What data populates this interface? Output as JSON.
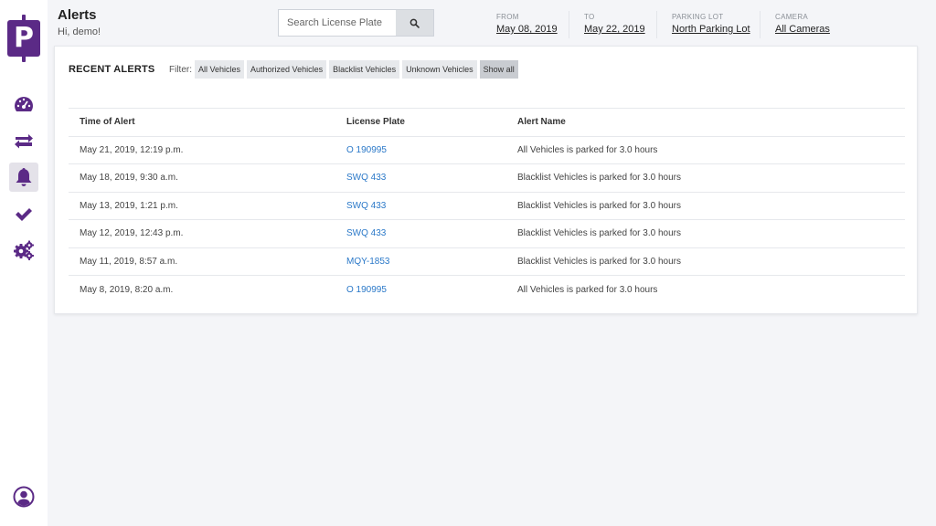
{
  "header": {
    "title": "Alerts",
    "greeting": "Hi, demo!",
    "search": {
      "placeholder": "Search License Plate",
      "value": ""
    },
    "filters": [
      {
        "label": "FROM",
        "value": "May 08, 2019"
      },
      {
        "label": "TO",
        "value": "May 22, 2019"
      },
      {
        "label": "PARKING LOT",
        "value": "North Parking Lot"
      },
      {
        "label": "CAMERA",
        "value": "All Cameras"
      }
    ]
  },
  "sidebar": {
    "logo_letter": "P",
    "brand_color": "#5b2a86",
    "items": [
      {
        "icon": "dashboard-icon"
      },
      {
        "icon": "transfer-arrows-icon"
      },
      {
        "icon": "bell-icon",
        "active": true
      },
      {
        "icon": "checkmark-icon"
      },
      {
        "icon": "gears-icon"
      }
    ],
    "profile_icon": "user-circle-icon"
  },
  "alerts": {
    "title": "RECENT ALERTS",
    "filter_label": "Filter:",
    "chips": [
      {
        "label": "All Vehicles"
      },
      {
        "label": "Authorized Vehicles"
      },
      {
        "label": "Blacklist Vehicles"
      },
      {
        "label": "Unknown Vehicles"
      },
      {
        "label": "Show all",
        "active": true
      }
    ],
    "columns": [
      "Time of Alert",
      "License Plate",
      "Alert Name"
    ],
    "rows": [
      {
        "time": "May 21, 2019, 12:19 p.m.",
        "plate": "O 190995",
        "name": "All Vehicles is parked for 3.0 hours"
      },
      {
        "time": "May 18, 2019, 9:30 a.m.",
        "plate": "SWQ 433",
        "name": "Blacklist Vehicles is parked for 3.0 hours"
      },
      {
        "time": "May 13, 2019, 1:21 p.m.",
        "plate": "SWQ 433",
        "name": "Blacklist Vehicles is parked for 3.0 hours"
      },
      {
        "time": "May 12, 2019, 12:43 p.m.",
        "plate": "SWQ 433",
        "name": "Blacklist Vehicles is parked for 3.0 hours"
      },
      {
        "time": "May 11, 2019, 8:57 a.m.",
        "plate": "MQY-1853",
        "name": "Blacklist Vehicles is parked for 3.0 hours"
      },
      {
        "time": "May 8, 2019, 8:20 a.m.",
        "plate": "O 190995",
        "name": "All Vehicles is parked for 3.0 hours"
      }
    ],
    "link_color": "#2a78c8"
  }
}
